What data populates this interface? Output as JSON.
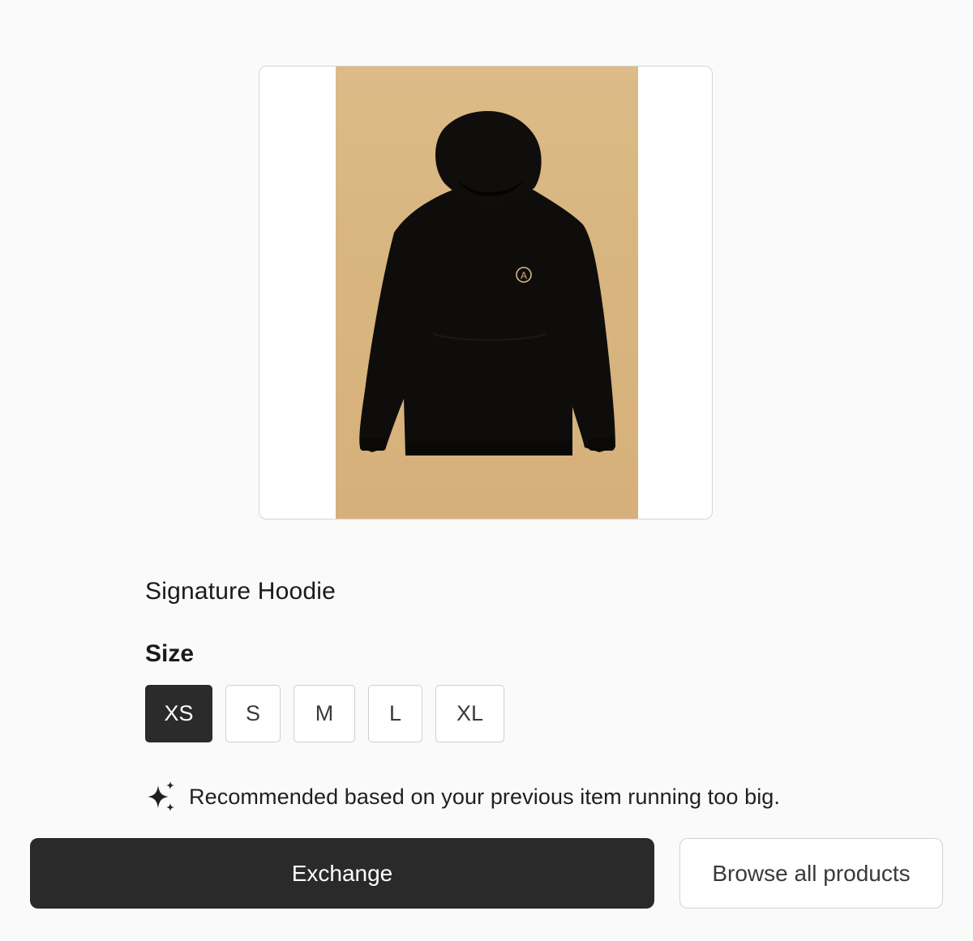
{
  "product": {
    "name": "Signature Hoodie",
    "image": {
      "background_color": "#d9b682",
      "garment_color": "#0f0d0b",
      "logo_letter": "A"
    }
  },
  "size": {
    "label": "Size",
    "options": [
      {
        "label": "XS",
        "selected": true
      },
      {
        "label": "S",
        "selected": false
      },
      {
        "label": "M",
        "selected": false
      },
      {
        "label": "L",
        "selected": false
      },
      {
        "label": "XL",
        "selected": false
      }
    ]
  },
  "recommendation": {
    "icon": "sparkle-icon",
    "text": "Recommended based on your previous item running too big."
  },
  "actions": {
    "exchange_label": "Exchange",
    "browse_label": "Browse all products"
  },
  "colors": {
    "primary_button": "#2a2a2a",
    "selected_size": "#2b2b2b",
    "page_background": "#fafafa"
  }
}
